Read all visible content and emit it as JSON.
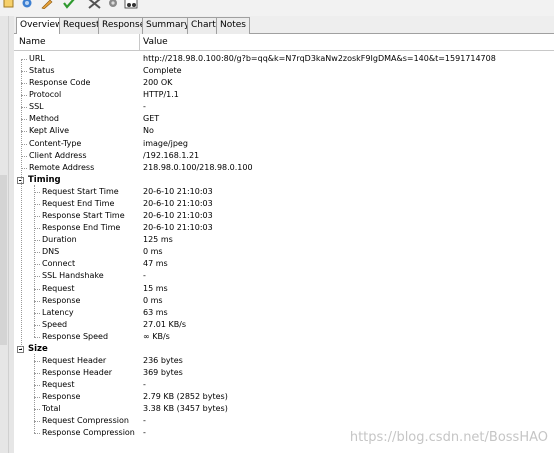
{
  "tabs": [
    {
      "label": "Overview"
    },
    {
      "label": "Request"
    },
    {
      "label": "Response"
    },
    {
      "label": "Summary"
    },
    {
      "label": "Chart"
    },
    {
      "label": "Notes"
    }
  ],
  "columns": {
    "name": "Name",
    "value": "Value"
  },
  "rows": [
    {
      "name": "URL",
      "value": "http://218.98.0.100:80/g?b=qq&k=N7rqD3kaNw2zoskF9IgDMA&s=140&t=1591714708"
    },
    {
      "name": "Status",
      "value": "Complete"
    },
    {
      "name": "Response Code",
      "value": "200 OK"
    },
    {
      "name": "Protocol",
      "value": "HTTP/1.1"
    },
    {
      "name": "SSL",
      "value": "-"
    },
    {
      "name": "Method",
      "value": "GET"
    },
    {
      "name": "Kept Alive",
      "value": "No"
    },
    {
      "name": "Content-Type",
      "value": "image/jpeg"
    },
    {
      "name": "Client Address",
      "value": "/192.168.1.21"
    },
    {
      "name": "Remote Address",
      "value": "218.98.0.100/218.98.0.100"
    },
    {
      "name": "Timing",
      "value": "",
      "group": true
    },
    {
      "name": "Request Start Time",
      "value": "20-6-10 21:10:03",
      "child": true
    },
    {
      "name": "Request End Time",
      "value": "20-6-10 21:10:03",
      "child": true
    },
    {
      "name": "Response Start Time",
      "value": "20-6-10 21:10:03",
      "child": true
    },
    {
      "name": "Response End Time",
      "value": "20-6-10 21:10:03",
      "child": true
    },
    {
      "name": "Duration",
      "value": "125 ms",
      "child": true
    },
    {
      "name": "DNS",
      "value": "0 ms",
      "child": true
    },
    {
      "name": "Connect",
      "value": "47 ms",
      "child": true
    },
    {
      "name": "SSL Handshake",
      "value": "-",
      "child": true
    },
    {
      "name": "Request",
      "value": "15 ms",
      "child": true
    },
    {
      "name": "Response",
      "value": "0 ms",
      "child": true
    },
    {
      "name": "Latency",
      "value": "63 ms",
      "child": true
    },
    {
      "name": "Speed",
      "value": "27.01 KB/s",
      "child": true
    },
    {
      "name": "Response Speed",
      "value": "∞ KB/s",
      "child": true
    },
    {
      "name": "Size",
      "value": "",
      "group": true
    },
    {
      "name": "Request Header",
      "value": "236 bytes",
      "child": true
    },
    {
      "name": "Response Header",
      "value": "369 bytes",
      "child": true
    },
    {
      "name": "Request",
      "value": "-",
      "child": true
    },
    {
      "name": "Response",
      "value": "2.79 KB (2852 bytes)",
      "child": true
    },
    {
      "name": "Total",
      "value": "3.38 KB (3457 bytes)",
      "child": true
    },
    {
      "name": "Request Compression",
      "value": "-",
      "child": true
    },
    {
      "name": "Response Compression",
      "value": "-",
      "child": true
    }
  ],
  "watermark": "https://blog.csdn.net/BossHAO"
}
